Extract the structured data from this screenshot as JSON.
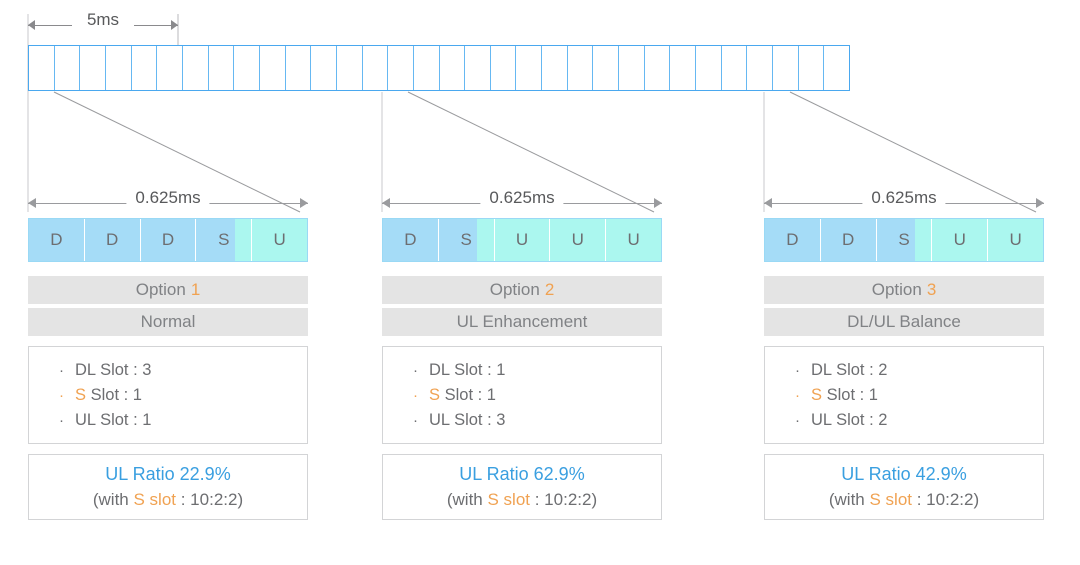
{
  "timeline": {
    "bracket_label": "5ms",
    "total_cells": 32,
    "bracket_cells": 8
  },
  "colors": {
    "dl_slot": "#a5dcf7",
    "ul_slot": "#abf7ef",
    "grid_border": "#4aa8ef",
    "accent_orange": "#f0a252",
    "ratio_blue": "#3a9fe0",
    "chip_bg": "#e4e4e4",
    "text_gray": "#6d6e71"
  },
  "options": [
    {
      "dim_label": "0.625ms",
      "slots": [
        {
          "glyph": "D",
          "kind": "dl"
        },
        {
          "glyph": "D",
          "kind": "dl"
        },
        {
          "glyph": "D",
          "kind": "dl"
        },
        {
          "glyph": "S",
          "kind": "s"
        },
        {
          "glyph": "U",
          "kind": "ul"
        }
      ],
      "title_prefix": "Option",
      "title_number": "1",
      "subtitle": "Normal",
      "bullets": [
        {
          "text": "DL Slot : 3",
          "highlight": false
        },
        {
          "text": "S Slot : 1",
          "highlight": true,
          "lead": "S",
          "rest": " Slot : 1"
        },
        {
          "text": "UL Slot : 1",
          "highlight": false
        }
      ],
      "ratio_main": "UL Ratio 22.9%",
      "ratio_sub_pre": "(with ",
      "ratio_sub_mid": "S slot",
      "ratio_sub_post": " : 10:2:2)"
    },
    {
      "dim_label": "0.625ms",
      "slots": [
        {
          "glyph": "D",
          "kind": "dl"
        },
        {
          "glyph": "S",
          "kind": "s"
        },
        {
          "glyph": "U",
          "kind": "ul"
        },
        {
          "glyph": "U",
          "kind": "ul"
        },
        {
          "glyph": "U",
          "kind": "ul"
        }
      ],
      "title_prefix": "Option",
      "title_number": "2",
      "subtitle": "UL Enhancement",
      "bullets": [
        {
          "text": "DL Slot : 1",
          "highlight": false
        },
        {
          "text": "S Slot : 1",
          "highlight": true,
          "lead": "S",
          "rest": " Slot : 1"
        },
        {
          "text": "UL Slot : 3",
          "highlight": false
        }
      ],
      "ratio_main": "UL Ratio 62.9%",
      "ratio_sub_pre": "(with ",
      "ratio_sub_mid": "S slot",
      "ratio_sub_post": " : 10:2:2)"
    },
    {
      "dim_label": "0.625ms",
      "slots": [
        {
          "glyph": "D",
          "kind": "dl"
        },
        {
          "glyph": "D",
          "kind": "dl"
        },
        {
          "glyph": "S",
          "kind": "s"
        },
        {
          "glyph": "U",
          "kind": "ul"
        },
        {
          "glyph": "U",
          "kind": "ul"
        }
      ],
      "title_prefix": "Option",
      "title_number": "3",
      "subtitle": "DL/UL Balance",
      "bullets": [
        {
          "text": "DL Slot : 2",
          "highlight": false
        },
        {
          "text": "S Slot : 1",
          "highlight": true,
          "lead": "S",
          "rest": " Slot : 1"
        },
        {
          "text": "UL Slot : 2",
          "highlight": false
        }
      ],
      "ratio_main": "UL Ratio 42.9%",
      "ratio_sub_pre": "(with ",
      "ratio_sub_mid": "S slot",
      "ratio_sub_post": " : 10:2:2)"
    }
  ]
}
